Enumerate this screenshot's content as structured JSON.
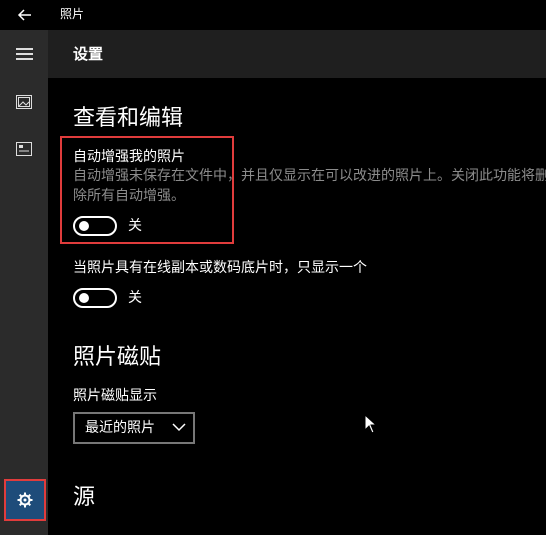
{
  "app": {
    "title": "照片"
  },
  "header": {
    "title": "设置"
  },
  "nav": {
    "items": [
      {
        "name": "menu",
        "icon": "hamburger-icon"
      },
      {
        "name": "collection",
        "icon": "photos-icon"
      },
      {
        "name": "albums",
        "icon": "album-icon"
      },
      {
        "name": "settings",
        "icon": "gear-icon"
      }
    ]
  },
  "sections": {
    "view_edit": {
      "title": "查看和编辑",
      "auto_enhance": {
        "label": "自动增强我的照片",
        "description": "自动增强未保存在文件中，并且仅显示在可以改进的照片上。关闭此功能将删除所有自动增强。",
        "state": "关",
        "on": false
      },
      "linked_dupes": {
        "label": "当照片具有在线副本或数码底片时，只显示一个",
        "state": "关",
        "on": false
      }
    },
    "tile": {
      "title": "照片磁贴",
      "label": "照片磁贴显示",
      "selected": "最近的照片"
    },
    "source": {
      "title": "源"
    }
  },
  "colors": {
    "accent": "#1e4c7a",
    "highlight": "#e03c3c",
    "nav_bg": "#2b2b2b",
    "header_bg": "#1f1f1f"
  }
}
